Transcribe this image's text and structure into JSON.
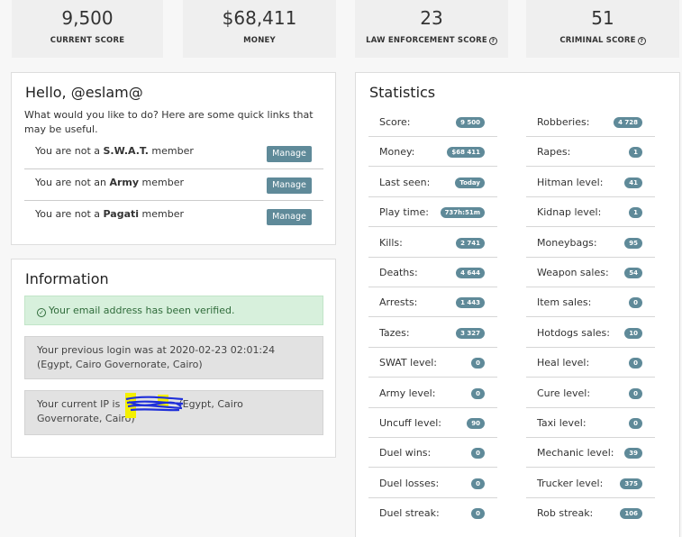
{
  "stats": [
    {
      "value": "9,500",
      "label": "CURRENT SCORE",
      "help": false
    },
    {
      "value": "$68,411",
      "label": "MONEY",
      "help": false
    },
    {
      "value": "23",
      "label": "LAW ENFORCEMENT SCORE",
      "help": true
    },
    {
      "value": "51",
      "label": "CRIMINAL SCORE",
      "help": true
    }
  ],
  "greeting": {
    "title": "Hello, @eslam@",
    "intro": "What would you like to do? Here are some quick links that may be useful.",
    "manage_label": "Manage",
    "members": [
      {
        "prefix": "You are not a ",
        "group": "S.W.A.T.",
        "suffix": " member"
      },
      {
        "prefix": "You are not an ",
        "group": "Army",
        "suffix": " member"
      },
      {
        "prefix": "You are not a ",
        "group": "Pagati",
        "suffix": " member"
      }
    ]
  },
  "information": {
    "title": "Information",
    "verified": "Your email address has been verified.",
    "previous_login": "Your previous login was at 2020-02-23 02:01:24 (Egypt, Cairo Governorate, Cairo)",
    "current_ip_prefix": "Your current IP is ",
    "current_ip_location": " (Egypt, Cairo Governorate, Cairo)"
  },
  "statistics": {
    "title": "Statistics",
    "left": [
      {
        "label": "Score:",
        "value": "9 500"
      },
      {
        "label": "Money:",
        "value": "$68 411"
      },
      {
        "label": "Last seen:",
        "value": "Today"
      },
      {
        "label": "Play time:",
        "value": "737h:51m"
      },
      {
        "label": "Kills:",
        "value": "2 741"
      },
      {
        "label": "Deaths:",
        "value": "4 644"
      },
      {
        "label": "Arrests:",
        "value": "1 443"
      },
      {
        "label": "Tazes:",
        "value": "3 327"
      },
      {
        "label": "SWAT level:",
        "value": "0"
      },
      {
        "label": "Army level:",
        "value": "0"
      },
      {
        "label": "Uncuff level:",
        "value": "90"
      },
      {
        "label": "Duel wins:",
        "value": "0"
      },
      {
        "label": "Duel losses:",
        "value": "0"
      },
      {
        "label": "Duel streak:",
        "value": "0"
      }
    ],
    "right": [
      {
        "label": "Robberies:",
        "value": "4 728"
      },
      {
        "label": "Rapes:",
        "value": "1"
      },
      {
        "label": "Hitman level:",
        "value": "41"
      },
      {
        "label": "Kidnap level:",
        "value": "1"
      },
      {
        "label": "Moneybags:",
        "value": "95"
      },
      {
        "label": "Weapon sales:",
        "value": "54"
      },
      {
        "label": "Item sales:",
        "value": "0"
      },
      {
        "label": "Hotdogs sales:",
        "value": "10"
      },
      {
        "label": "Heal level:",
        "value": "0"
      },
      {
        "label": "Cure level:",
        "value": "0"
      },
      {
        "label": "Taxi level:",
        "value": "0"
      },
      {
        "label": "Mechanic level:",
        "value": "39"
      },
      {
        "label": "Trucker level:",
        "value": "375"
      },
      {
        "label": "Rob streak:",
        "value": "106"
      }
    ]
  },
  "colors": {
    "badge": "#5f8a99",
    "success_bg": "#d7f0dc",
    "grey_alert_bg": "#e2e2e2"
  }
}
